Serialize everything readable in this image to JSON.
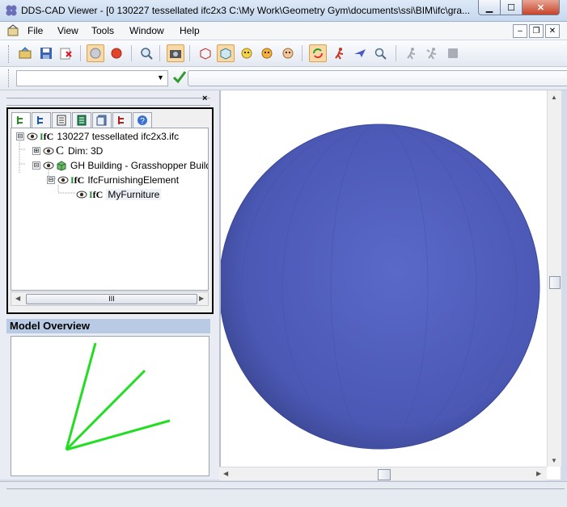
{
  "window": {
    "title": "DDS-CAD Viewer - [0  130227 tessellated ifc2x3  C:\\My Work\\Geometry Gym\\documents\\ssi\\BIM\\ifc\\gra...",
    "minimize_glyph": "▁",
    "maximize_glyph": "☐",
    "close_glyph": "✕"
  },
  "menu": {
    "items": [
      "File",
      "View",
      "Tools",
      "Window",
      "Help"
    ],
    "mdi_min": "–",
    "mdi_restore": "❐",
    "mdi_close": "✕"
  },
  "toolbar": {
    "icons": [
      "open-icon",
      "save-icon",
      "close-file-icon",
      "toggle-icon",
      "stop-icon",
      "zoom-icon",
      "camera-icon",
      "box-icon",
      "box-selected-icon",
      "face-icon",
      "face-alt-icon",
      "face-color-icon",
      "refresh-icon",
      "walk-icon",
      "fly-icon",
      "search-icon",
      "person-icon",
      "person-alt-icon",
      "stop-square-icon"
    ]
  },
  "cmdbar": {
    "select_value": "",
    "input_value": ""
  },
  "left_pane": {
    "close_glyph": "×",
    "tabs": [
      "tree-tab-1",
      "tree-tab-2",
      "tree-tab-3",
      "tree-tab-4",
      "tree-tab-5",
      "tree-tab-6",
      "help-tab"
    ],
    "tree": [
      {
        "level": 0,
        "expander": "⊟",
        "label": "130227 tessellated ifc2x3.ifc"
      },
      {
        "level": 1,
        "expander": "⊞",
        "label": "Dim: 3D"
      },
      {
        "level": 1,
        "expander": "⊟",
        "label": "GH Building - Grasshopper Building"
      },
      {
        "level": 2,
        "expander": "⊟",
        "label": "IfcFurnishingElement"
      },
      {
        "level": 3,
        "expander": "",
        "label": "MyFurniture"
      }
    ],
    "hscroll_grip": "III",
    "overview_title": "Model Overview"
  },
  "viewport": {
    "sphere_color": "#5360b8"
  },
  "colors": {
    "overview_lines": "#22dd22",
    "titlebar": "#c6d8ef",
    "close_button": "#c7432a"
  }
}
